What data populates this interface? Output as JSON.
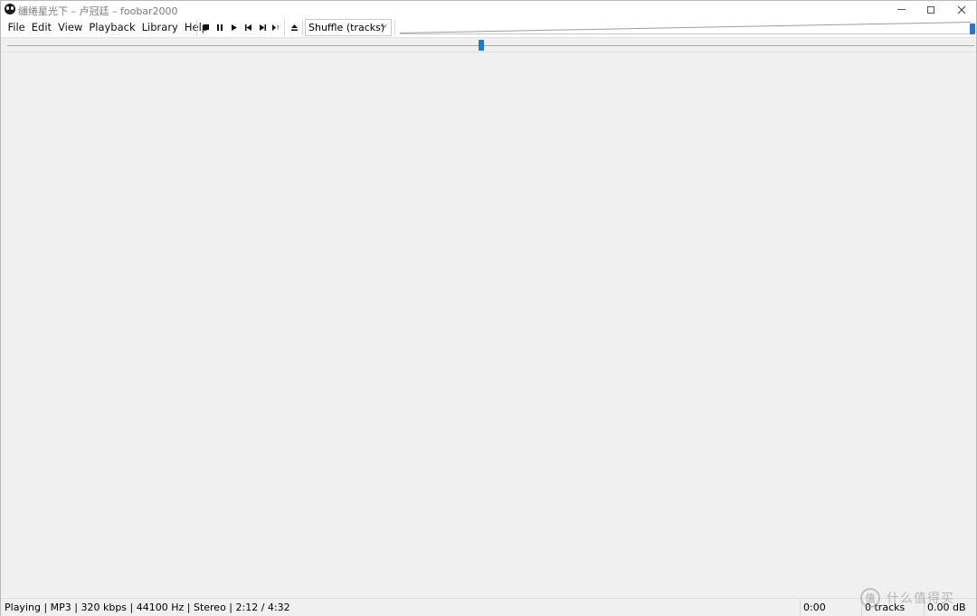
{
  "window": {
    "title": "缱绻星光下 – 卢冠廷 – foobar2000"
  },
  "menu": [
    "File",
    "Edit",
    "View",
    "Playback",
    "Library",
    "Help"
  ],
  "controls": {
    "stop": "stop-icon",
    "pause": "pause-icon",
    "play": "play-icon",
    "previous": "previous-icon",
    "next": "next-icon",
    "random": "random-icon",
    "open": "eject-icon"
  },
  "playback_order": {
    "selected": "Shuffle (tracks)"
  },
  "volume": {
    "level_fraction": 1.0
  },
  "seekbar": {
    "position_fraction": 0.49
  },
  "status": {
    "main": "Playing | MP3 | 320 kbps | 44100 Hz | Stereo | 2:12 / 4:32",
    "time": "0:00",
    "tracks": "0 tracks",
    "gain": "0.00 dB"
  },
  "watermark": {
    "text": "什么值得买",
    "logo_glyph": "值"
  },
  "colors": {
    "accent": "#1e79d4",
    "background": "#f0f0f0"
  }
}
